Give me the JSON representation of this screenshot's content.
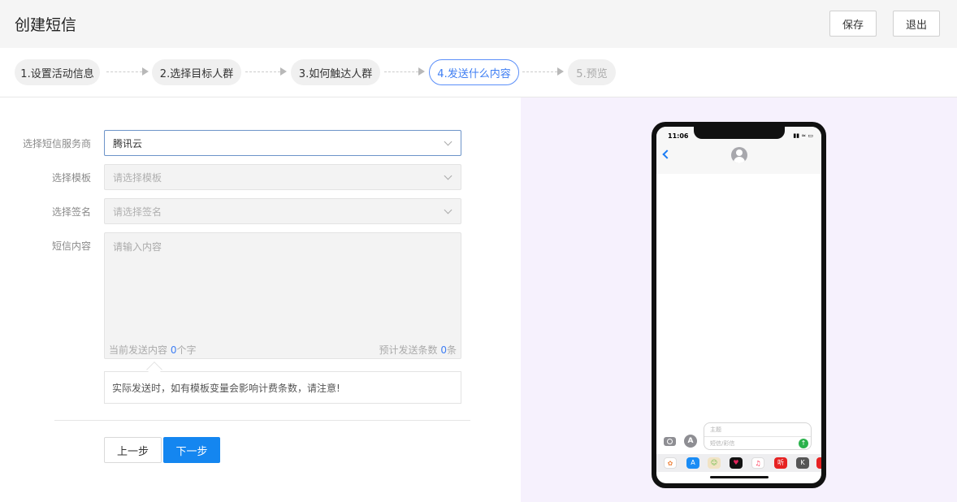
{
  "header": {
    "title": "创建短信",
    "save_label": "保存",
    "exit_label": "退出"
  },
  "steps": [
    {
      "label": "1.设置活动信息",
      "state": "done"
    },
    {
      "label": "2.选择目标人群",
      "state": "done"
    },
    {
      "label": "3.如何触达人群",
      "state": "done"
    },
    {
      "label": "4.发送什么内容",
      "state": "active"
    },
    {
      "label": "5.预览",
      "state": "future"
    }
  ],
  "form": {
    "provider": {
      "label": "选择短信服务商",
      "value": "腾讯云"
    },
    "template": {
      "label": "选择模板",
      "placeholder": "请选择模板"
    },
    "signature": {
      "label": "选择签名",
      "placeholder": "请选择签名"
    },
    "content": {
      "label": "短信内容",
      "placeholder": "请输入内容",
      "count_prefix": "当前发送内容 ",
      "count_value": "0",
      "count_suffix": "个字",
      "est_prefix": "预计发送条数 ",
      "est_value": "0",
      "est_suffix": "条"
    },
    "notice": "实际发送时，如有模板变量会影响计费条数，请注意!",
    "prev_label": "上一步",
    "next_label": "下一步"
  },
  "phone": {
    "time": "11:06",
    "subject_placeholder": "主题",
    "message_placeholder": "短信/彩信",
    "app_listen": "听"
  },
  "colors": {
    "accent": "#1486f0",
    "active_step": "#3e7ef3",
    "preview_bg": "#f6f1fd"
  }
}
